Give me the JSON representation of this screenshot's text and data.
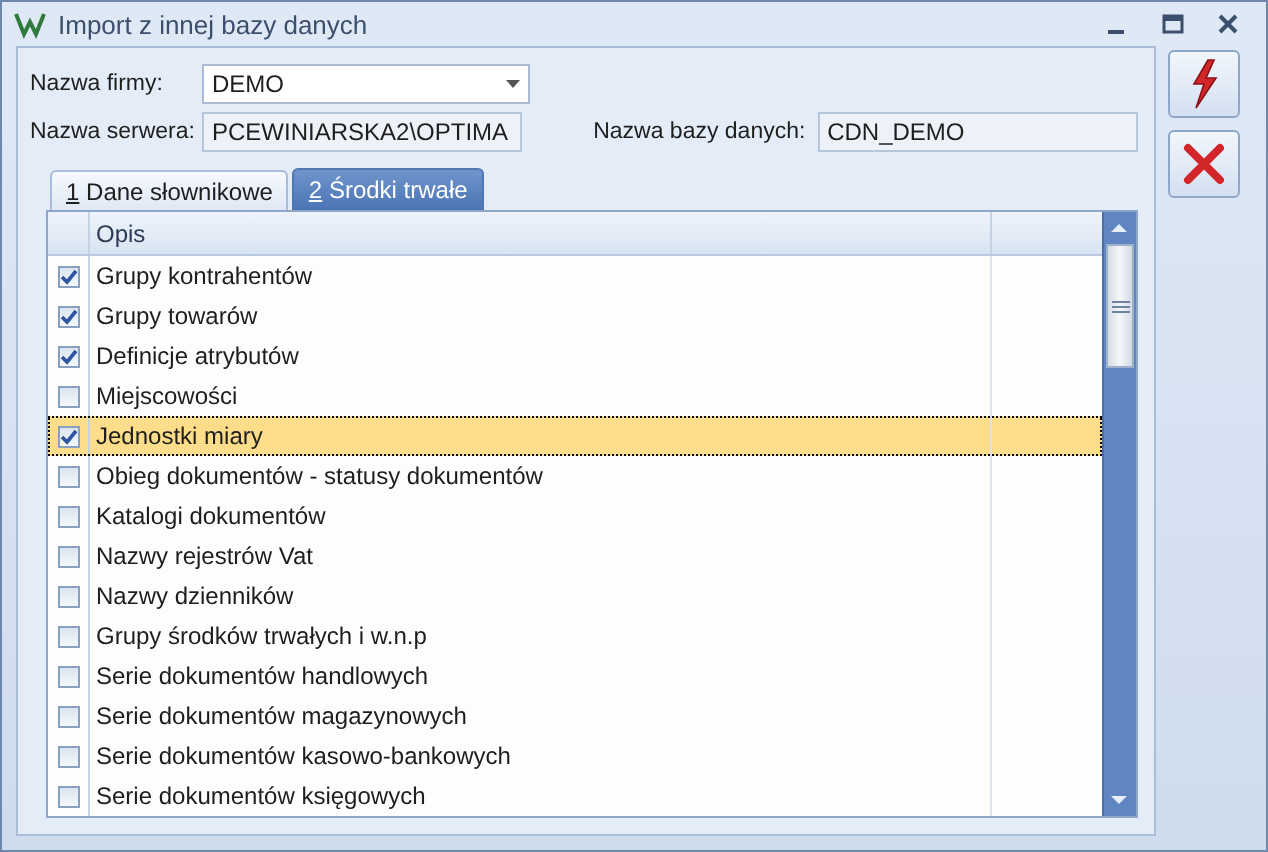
{
  "window": {
    "title": "Import z innej bazy danych"
  },
  "form": {
    "company_label": "Nazwa firmy:",
    "company_value": "DEMO",
    "server_label": "Nazwa serwera:",
    "server_value": "PCEWINIARSKA2\\OPTIMA",
    "database_label": "Nazwa bazy danych:",
    "database_value": "CDN_DEMO"
  },
  "tabs": [
    {
      "mnemonic": "1",
      "label": "Dane słownikowe",
      "selected": false
    },
    {
      "mnemonic": "2",
      "label": "Środki trwałe",
      "selected": true
    }
  ],
  "table": {
    "columns": [
      "Opis"
    ],
    "rows": [
      {
        "label": "Grupy kontrahentów",
        "checked": true,
        "selected": false
      },
      {
        "label": "Grupy towarów",
        "checked": true,
        "selected": false
      },
      {
        "label": "Definicje atrybutów",
        "checked": true,
        "selected": false
      },
      {
        "label": "Miejscowości",
        "checked": false,
        "selected": false
      },
      {
        "label": "Jednostki miary",
        "checked": true,
        "selected": true
      },
      {
        "label": "Obieg dokumentów - statusy dokumentów",
        "checked": false,
        "selected": false
      },
      {
        "label": "Katalogi dokumentów",
        "checked": false,
        "selected": false
      },
      {
        "label": "Nazwy rejestrów Vat",
        "checked": false,
        "selected": false
      },
      {
        "label": "Nazwy dzienników",
        "checked": false,
        "selected": false
      },
      {
        "label": "Grupy środków trwałych i w.n.p",
        "checked": false,
        "selected": false
      },
      {
        "label": "Serie dokumentów handlowych",
        "checked": false,
        "selected": false
      },
      {
        "label": "Serie dokumentów magazynowych",
        "checked": false,
        "selected": false
      },
      {
        "label": "Serie dokumentów kasowo-bankowych",
        "checked": false,
        "selected": false
      },
      {
        "label": "Serie dokumentów księgowych",
        "checked": false,
        "selected": false
      }
    ]
  }
}
